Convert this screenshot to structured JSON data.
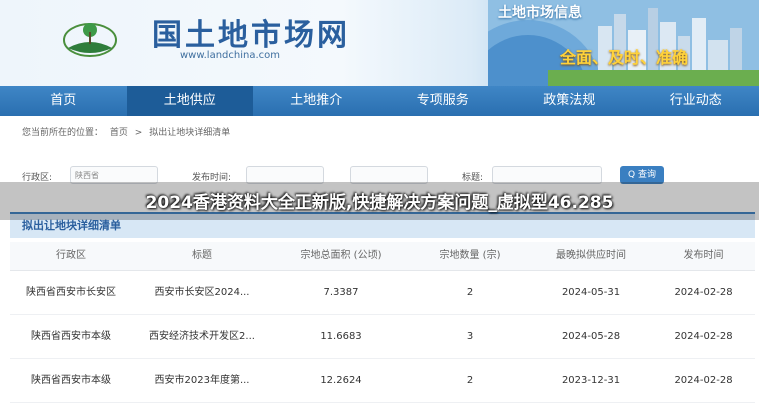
{
  "header": {
    "site_title": "国土地市场网",
    "site_url": "www.landchina.com",
    "banner_title": "土地市场信息",
    "slogan": "全面、及时、准确"
  },
  "nav": {
    "items": [
      "首页",
      "土地供应",
      "土地推介",
      "专项服务",
      "政策法规",
      "行业动态"
    ],
    "active_index": 1
  },
  "breadcrumb": {
    "prefix": "您当前所在的位置：",
    "items": [
      "首页",
      "拟出让地块详细清单"
    ]
  },
  "filters": {
    "region_label": "行政区:",
    "region_value": "陕西省",
    "publish_label": "发布时间:",
    "title_label": "标题:",
    "search_label": "Q 查询"
  },
  "overlay_title": "2024香港资料大全正新版,快捷解决方案问题_虚拟型46.285",
  "section_title": "拟出让地块详细清单",
  "table": {
    "headers": [
      "行政区",
      "标题",
      "宗地总面积 (公顷)",
      "宗地数量 (宗)",
      "最晚拟供应时间",
      "发布时间"
    ],
    "rows": [
      [
        "陕西省西安市长安区",
        "西安市长安区2024...",
        "7.3387",
        "2",
        "2024-05-31",
        "2024-02-28"
      ],
      [
        "陕西省西安市本级",
        "西安经济技术开发区2...",
        "11.6683",
        "3",
        "2024-05-28",
        "2024-02-28"
      ],
      [
        "陕西省西安市本级",
        "西安市2023年度第...",
        "12.2624",
        "2",
        "2023-12-31",
        "2024-02-28"
      ]
    ]
  },
  "colors": {
    "nav_bg": "#2a6fb0",
    "title_blue": "#2a5f9e",
    "slogan_yellow": "#ffd23a"
  }
}
